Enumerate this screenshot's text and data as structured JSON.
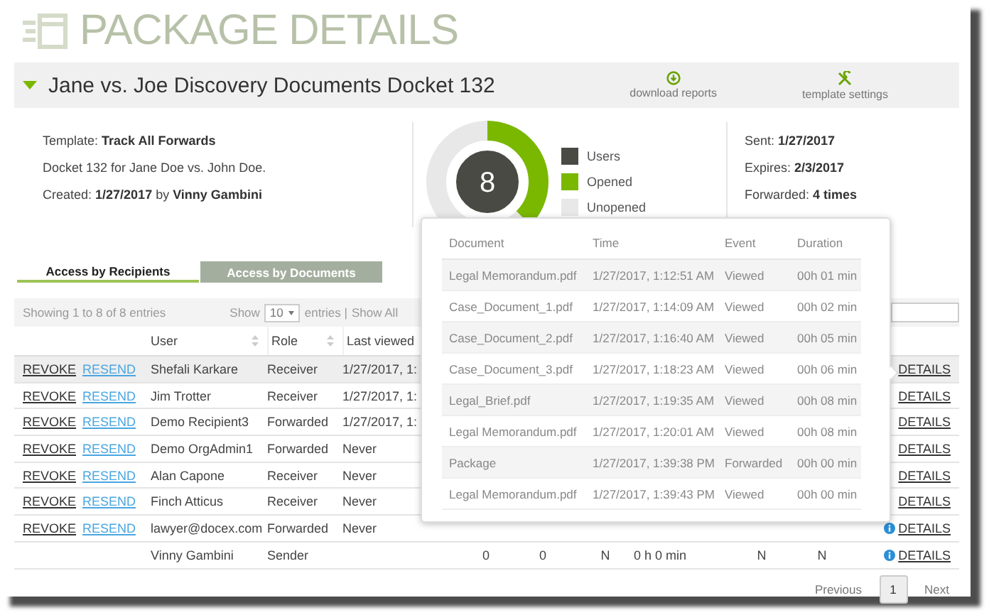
{
  "title": "PACKAGE DETAILS",
  "package": {
    "name": "Jane vs. Joe Discovery Documents Docket 132",
    "expanded": true,
    "actions": [
      {
        "label": "download reports",
        "kind": "download"
      },
      {
        "label": "template settings",
        "kind": "settings"
      }
    ]
  },
  "info": [
    "Template: **Track All Forwards**",
    "Docket 132 for Jane Doe vs. John Doe.",
    "Created: **1/27/2017** by **Vinny Gambini**"
  ],
  "donut": {
    "total": "8",
    "level": 0.375,
    "legend": [
      {
        "label": "Users",
        "color": "#4a4a45"
      },
      {
        "label": "Opened",
        "color": "#7ab800"
      },
      {
        "label": "Unopened",
        "color": "#e8e8e8"
      }
    ]
  },
  "dates": [
    "Sent: **1/27/2017**",
    "Expires: **2/3/2017**",
    "Forwarded: **4 times**"
  ],
  "tabs": [
    {
      "label": "Access by Recipients",
      "selected": true
    },
    {
      "label": "Access by Documents",
      "selected": false
    }
  ],
  "table": {
    "info": "Showing 1 to 8 of 8 entries",
    "show": "Show",
    "page_size": "10",
    "entries": "entries |",
    "show_all": "Show All",
    "columns": [
      {
        "label": "User",
        "sortable": true
      },
      {
        "label": "Role",
        "sortable": true
      },
      {
        "label": "Last viewed",
        "sortable": false
      }
    ],
    "rows": [
      {
        "revoke": "REVOKE",
        "resend": "RESEND",
        "user": "Shefali Karkare",
        "role": "Receiver",
        "last_viewed": "1/27/2017, 1:",
        "details": "DETAILS",
        "info_icon": false,
        "selected": true
      },
      {
        "revoke": "REVOKE",
        "resend": "RESEND",
        "user": "Jim Trotter",
        "role": "Receiver",
        "last_viewed": "1/27/2017, 1:",
        "details": "DETAILS",
        "info_icon": false,
        "selected": false
      },
      {
        "revoke": "REVOKE",
        "resend": "RESEND",
        "user": "Demo Recipient3",
        "role": "Forwarded",
        "last_viewed": "1/27/2017, 1:",
        "details": "DETAILS",
        "info_icon": false,
        "selected": false
      },
      {
        "revoke": "REVOKE",
        "resend": "RESEND",
        "user": "Demo OrgAdmin1",
        "role": "Forwarded",
        "last_viewed": "Never",
        "details": "DETAILS",
        "info_icon": false,
        "selected": false
      },
      {
        "revoke": "REVOKE",
        "resend": "RESEND",
        "user": "Alan Capone",
        "role": "Receiver",
        "last_viewed": "Never",
        "details": "DETAILS",
        "info_icon": false,
        "selected": false
      },
      {
        "revoke": "REVOKE",
        "resend": "RESEND",
        "user": "Finch Atticus",
        "role": "Receiver",
        "last_viewed": "Never",
        "details": "DETAILS",
        "info_icon": false,
        "selected": false
      },
      {
        "revoke": "REVOKE",
        "resend": "RESEND",
        "user": "lawyer@docex.com",
        "role": "Forwarded",
        "last_viewed": "Never",
        "details": "DETAILS",
        "info_icon": true,
        "selected": false
      },
      {
        "user": "Vinny Gambini",
        "role": "Sender",
        "cells": [
          "0",
          "0",
          "N",
          "0 h 0 min",
          "N",
          "N"
        ],
        "details": "DETAILS",
        "info_icon": true,
        "selected": false
      }
    ]
  },
  "pagination": {
    "previous": "Previous",
    "pages": [
      {
        "label": "1",
        "selected": true
      }
    ],
    "next": "Next"
  },
  "popup": {
    "columns": [
      "Document",
      "Time",
      "Event",
      "Duration"
    ],
    "rows": [
      [
        "Legal Memorandum.pdf",
        "1/27/2017, 1:12:51 AM",
        "Viewed",
        "00h 01 min"
      ],
      [
        "Case_Document_1.pdf",
        "1/27/2017, 1:14:09 AM",
        "Viewed",
        "00h 02 min"
      ],
      [
        "Case_Document_2.pdf",
        "1/27/2017, 1:16:40 AM",
        "Viewed",
        "00h 05 min"
      ],
      [
        "Case_Document_3.pdf",
        "1/27/2017, 1:18:23 AM",
        "Viewed",
        "00h 06 min"
      ],
      [
        "Legal_Brief.pdf",
        "1/27/2017, 1:19:35 AM",
        "Viewed",
        "00h 08 min"
      ],
      [
        "Legal Memorandum.pdf",
        "1/27/2017, 1:20:01 AM",
        "Viewed",
        "00h 08 min"
      ],
      [
        "Package",
        "1/27/2017, 1:39:38 PM",
        "Forwarded",
        "00h 00 min"
      ],
      [
        "Legal Memorandum.pdf",
        "1/27/2017, 1:39:43 PM",
        "Viewed",
        "00h 00 min"
      ]
    ]
  }
}
